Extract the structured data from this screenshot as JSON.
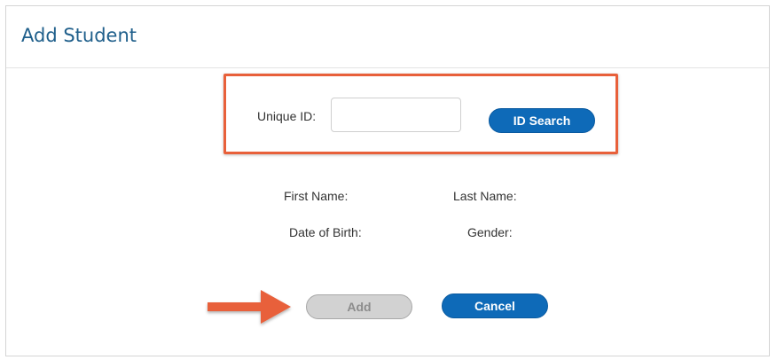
{
  "dialog": {
    "title": "Add Student"
  },
  "search": {
    "unique_id_label": "Unique ID:",
    "unique_id_value": "",
    "unique_id_placeholder": "",
    "search_button_label": "ID Search"
  },
  "student_info": {
    "first_name_label": "First Name:",
    "last_name_label": "Last Name:",
    "dob_label": "Date of Birth:",
    "gender_label": "Gender:"
  },
  "actions": {
    "add_label": "Add",
    "add_enabled": false,
    "cancel_label": "Cancel"
  },
  "annotations": {
    "highlight_color": "#e8603a",
    "arrow_icon": "arrow-right-icon"
  },
  "colors": {
    "title": "#1f5f8b",
    "primary_button": "#0e6ab8",
    "disabled_button": "#d2d2d2"
  }
}
